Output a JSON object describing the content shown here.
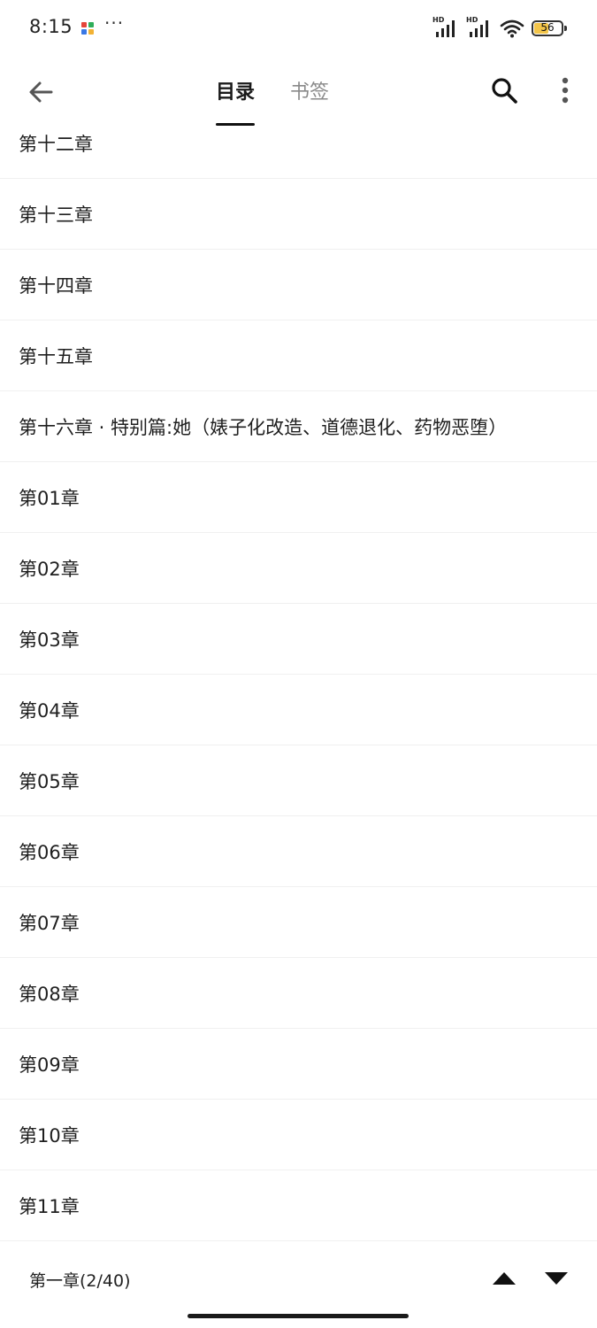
{
  "status_bar": {
    "time": "8:15",
    "dots": "···",
    "signal_badge": "HD",
    "battery_level": "56",
    "battery_fraction": 0.56
  },
  "header": {
    "tabs": [
      {
        "label": "目录",
        "active": true
      },
      {
        "label": "书签",
        "active": false
      }
    ],
    "icons": [
      "arrow-back-icon",
      "search-icon",
      "more-vert-icon"
    ]
  },
  "chapters": [
    "第十二章",
    "第十三章",
    "第十四章",
    "第十五章",
    "第十六章 · 特别篇:她（婊子化改造、道德退化、药物恶堕）",
    "第01章",
    "第02章",
    "第03章",
    "第04章",
    "第05章",
    "第06章",
    "第07章",
    "第08章",
    "第09章",
    "第10章",
    "第11章"
  ],
  "footer": {
    "current_chapter": "第一章(2/40)"
  },
  "colors": {
    "text": "#1f1f1f",
    "tab_inactive": "#8a8a8a",
    "divider": "#f0f0f0",
    "battery": "#f3c54a"
  }
}
